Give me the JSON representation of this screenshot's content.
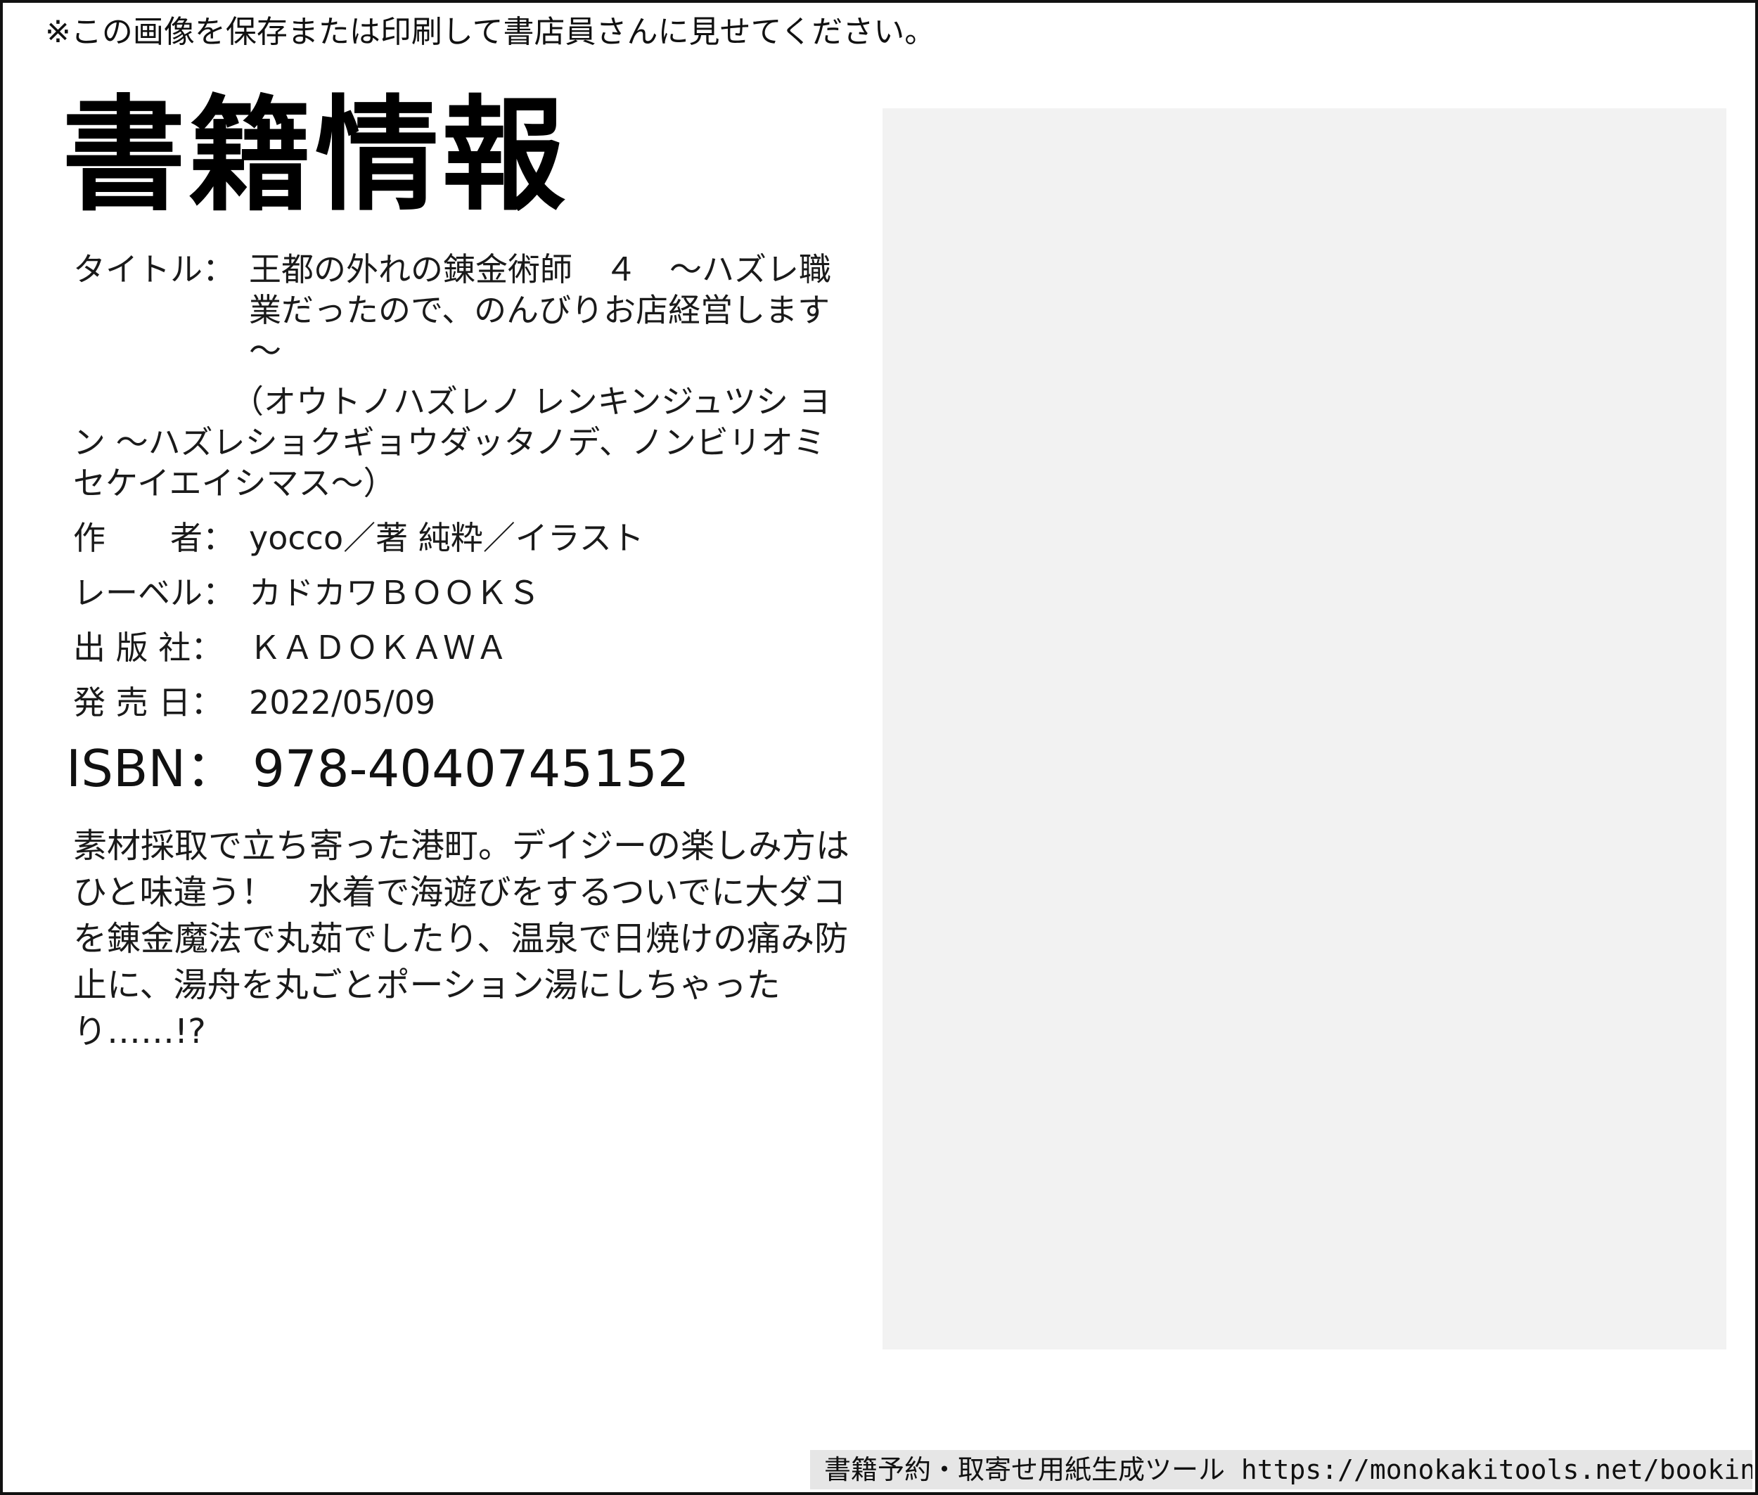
{
  "notice": "※この画像を保存または印刷して書店員さんに見せてください。",
  "heading": "書籍情報",
  "book": {
    "title_label": "タイトル：",
    "title": "王都の外れの錬金術師　４　～ハズレ職業だったので、のんびりお店経営します～",
    "reading": "（オウトノハズレノ レンキンジュツシ ヨン ～ハズレショクギョウダッタノデ、ノンビリオミセケイエイシマス～）",
    "author_label": "作　　者：",
    "author": "yocco／著 純粋／イラスト",
    "label_label": "レーベル：",
    "label": "カドカワＢＯＯＫＳ",
    "publisher_label": "出 版 社：",
    "publisher": "ＫＡＤＯＫＡＷＡ",
    "date_label": "発 売 日：",
    "date": "2022/05/09",
    "isbn": "ISBN： 978-4040745152",
    "description": "素材採取で立ち寄った港町。デイジーの楽しみ方はひと味違う！　水着で海遊びをするついでに大ダコを錬金魔法で丸茹でしたり、温泉で日焼けの痛み防止に、湯舟を丸ごとポーション湯にしちゃったり……!?"
  },
  "footer": "書籍予約・取寄せ用紙生成ツール https://monokakitools.net/bookinfo/"
}
